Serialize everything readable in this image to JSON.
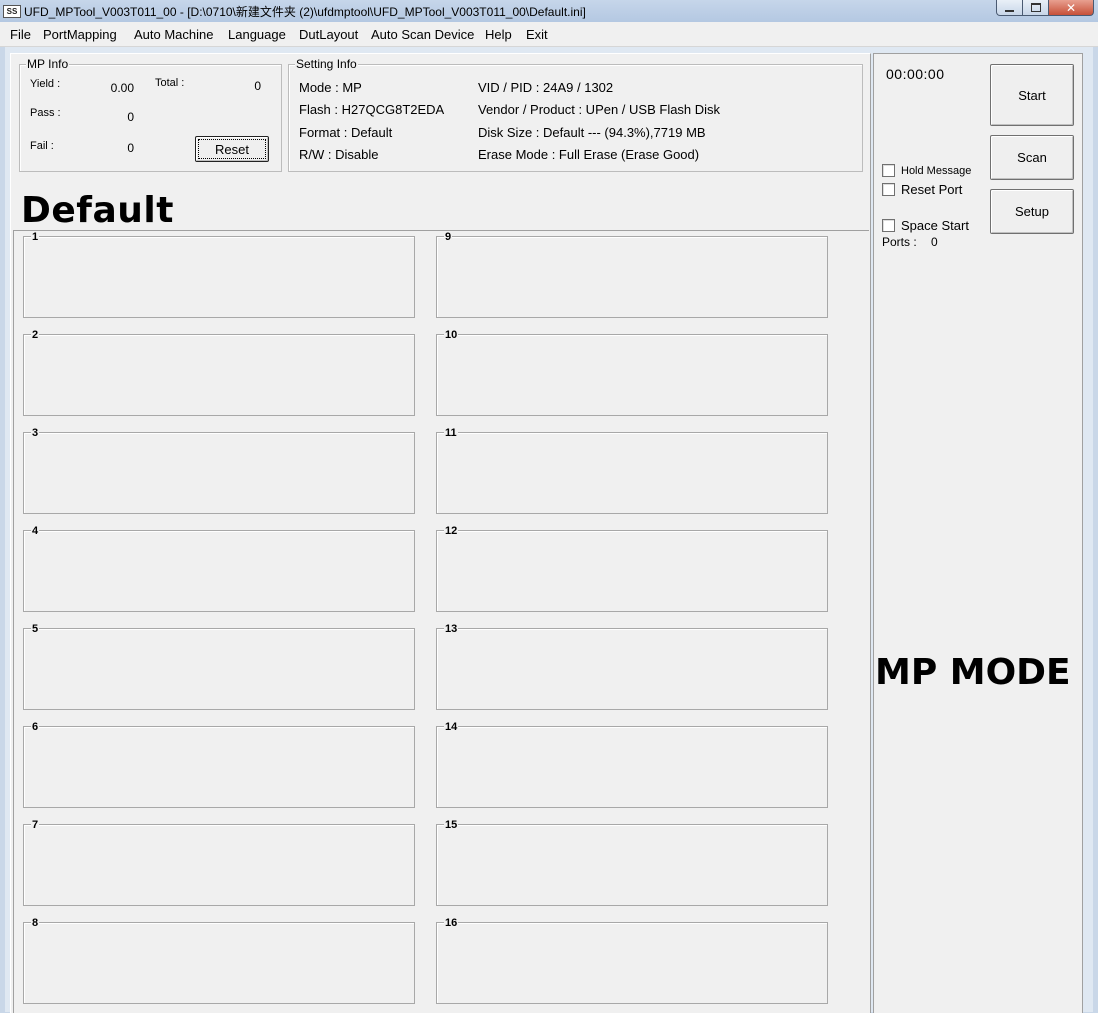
{
  "window": {
    "title": "UFD_MPTool_V003T011_00 - [D:\\0710\\新建文件夹 (2)\\ufdmptool\\UFD_MPTool_V003T011_00\\Default.ini]",
    "icon_text": "SS",
    "controls": {
      "minimize": "",
      "maximize": "",
      "close": "✕"
    }
  },
  "menu": [
    "File",
    "PortMapping",
    "Auto Machine",
    "Language",
    "DutLayout",
    "Auto Scan Device",
    "Help",
    "Exit"
  ],
  "mp_info": {
    "legend": "MP Info",
    "yield_label": "Yield :",
    "yield_value": "0.00",
    "total_label": "Total :",
    "total_value": "0",
    "pass_label": "Pass :",
    "pass_value": "0",
    "fail_label": "Fail :",
    "fail_value": "0",
    "reset_label": "Reset"
  },
  "setting_info": {
    "legend": "Setting Info",
    "mode": "Mode : MP",
    "flash": "Flash : H27QCG8T2EDA",
    "format": "Format : Default",
    "rw": "R/W : Disable",
    "vid_pid": "VID / PID : 24A9 / 1302",
    "vendor_product": "Vendor / Product : UPen / USB Flash Disk",
    "disk_size": "Disk Size : Default --- (94.3%),7719 MB",
    "erase_mode": "Erase Mode : Full Erase (Erase Good)"
  },
  "profile_name": "Default",
  "slots": [
    "1",
    "2",
    "3",
    "4",
    "5",
    "6",
    "7",
    "8",
    "9",
    "10",
    "11",
    "12",
    "13",
    "14",
    "15",
    "16"
  ],
  "side": {
    "timer": "00:00:00",
    "start_label": "Start",
    "scan_label": "Scan",
    "setup_label": "Setup",
    "hold_message": "Hold Message",
    "reset_port": "Reset Port",
    "space_start": "Space Start",
    "ports_label": "Ports :",
    "ports_value": "0",
    "mode_banner": "MP MODE"
  }
}
